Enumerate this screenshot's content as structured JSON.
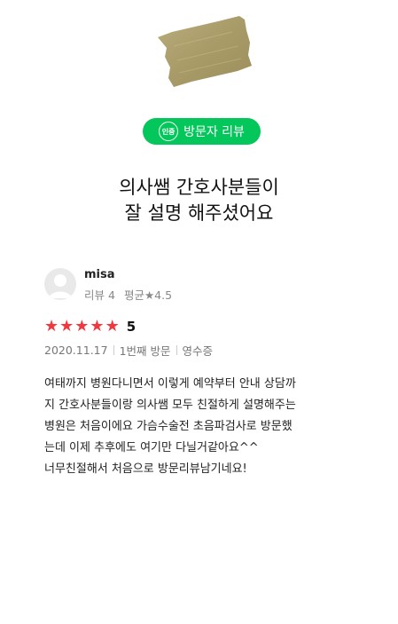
{
  "badge": {
    "icon_label": "인증",
    "label": "방문자 리뷰",
    "color": "#03c75a"
  },
  "headline": {
    "line1": "의사쌤 간호사분들이",
    "line2": "잘 설명 해주셨어요"
  },
  "reviewer": {
    "name": "misa",
    "review_count": "리뷰 4",
    "average_rating": "평균★4.5",
    "avatar_icon": "user-silhouette-icon"
  },
  "rating": {
    "stars": 5,
    "max_stars": 5,
    "value": "5",
    "star_color": "#f0383e"
  },
  "meta": {
    "date": "2020.11.17",
    "visit_count": "1번째 방문",
    "verification": "영수증"
  },
  "review": {
    "text": "여태까지 병원다니면서 이렇게 예약부터 안내 상담까\n지 간호사분들이랑 의사쌤 모두 친절하게 설명해주는\n병원은 처음이에요 가슴수술전 초음파검사로 방문했\n는데 이제 추후에도 여기만 다닐거같아요^^\n너무친절해서 처음으로 방문리뷰남기네요!"
  }
}
